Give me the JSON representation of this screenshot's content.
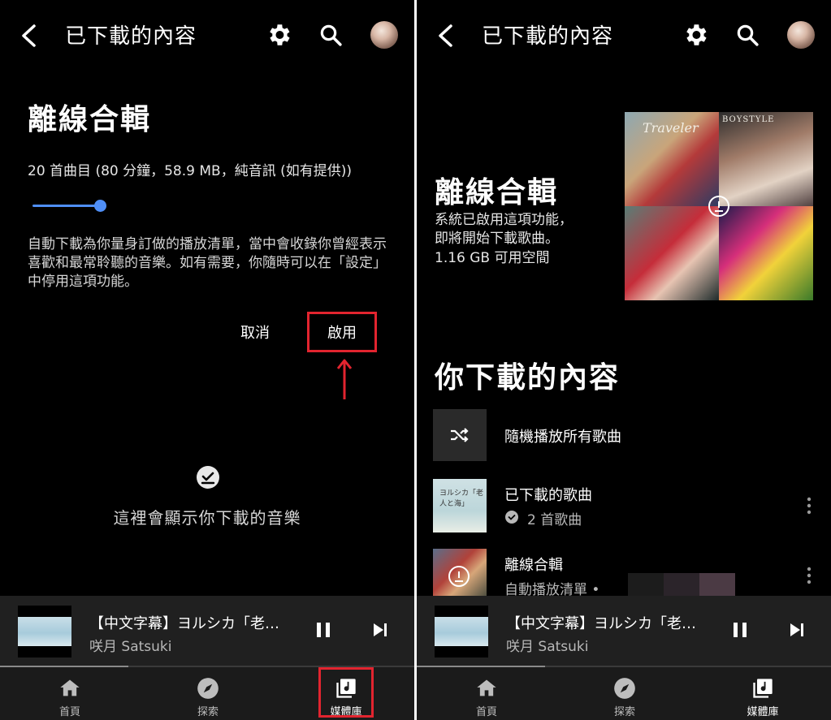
{
  "colors": {
    "accent_blue": "#4f8ff7",
    "highlight_red": "#e2242f",
    "panel_bg": "#000000",
    "player_bg": "#202020"
  },
  "left_screen": {
    "header": {
      "title": "已下載的內容"
    },
    "offline_mix": {
      "title": "離線合輯",
      "meta": "20 首曲目 (80 分鐘，58.9 MB，純音訊 (如有提供))",
      "slider_fraction": 0.25,
      "description": "自動下載為你量身訂做的播放清單，當中會收錄你曾經表示喜歡和最常聆聽的音樂。如有需要，你隨時可以在「設定」中停用這項功能。",
      "cancel_label": "取消",
      "enable_label": "啟用"
    },
    "empty_state": {
      "text": "這裡會顯示你下載的音樂"
    },
    "player": {
      "title": "【中文字幕】ヨルシカ「老…",
      "artist": "咲月 Satsuki",
      "progress_fraction": 0.31
    },
    "nav": [
      {
        "label": "首頁"
      },
      {
        "label": "探索"
      },
      {
        "label": "媒體庫"
      }
    ]
  },
  "right_screen": {
    "header": {
      "title": "已下載的內容"
    },
    "offline_mix": {
      "title": "離線合輯",
      "status_line1": "系統已啟用這項功能，",
      "status_line2": "即將開始下載歌曲。",
      "status_line3": "1.16 GB 可用空間"
    },
    "collage": {
      "tile1_text": "Traveler",
      "tile2_text": "BOYSTYLE"
    },
    "section_title": "你下載的內容",
    "shuffle_label": "隨機播放所有歌曲",
    "items": [
      {
        "title": "已下載的歌曲",
        "subtitle": "2 首歌曲",
        "thumb_text": "ヨルシカ「老人と海」"
      },
      {
        "title": "離線合輯",
        "subtitle": "自動播放清單 •"
      }
    ],
    "player": {
      "title": "【中文字幕】ヨルシカ「老…",
      "artist": "咲月 Satsuki",
      "progress_fraction": 0.31
    },
    "nav": [
      {
        "label": "首頁"
      },
      {
        "label": "探索"
      },
      {
        "label": "媒體庫"
      }
    ]
  }
}
